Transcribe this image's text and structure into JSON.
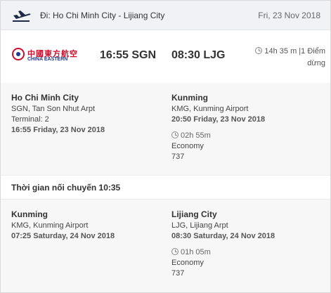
{
  "header": {
    "route": "Đi: Ho Chi Minh City - Lijiang City",
    "date": "Fri, 23 Nov 2018",
    "icon": "plane-departure-icon"
  },
  "summary": {
    "airline_logo_cn": "中國東方航空",
    "airline_logo_en": "CHINA EASTERN",
    "departure": "16:55 SGN",
    "arrival": "08:30 LJG",
    "duration": "14h 35 m |1 Điểm dừng"
  },
  "segments": [
    {
      "from": {
        "city": "Ho Chi Minh City",
        "airport": "SGN, Tan Son Nhut Arpt",
        "terminal": "Terminal: 2",
        "datetime": "16:55 Friday, 23 Nov 2018"
      },
      "to": {
        "city": "Kunming",
        "airport": "KMG, Kunming Airport",
        "datetime": "20:50 Friday, 23 Nov 2018",
        "duration": "02h 55m",
        "cabin": "Economy",
        "aircraft": "737"
      }
    },
    {
      "from": {
        "city": "Kunming",
        "airport": "KMG, Kunming Airport",
        "datetime": "07:25 Saturday, 24 Nov 2018"
      },
      "to": {
        "city": "Lijiang City",
        "airport": "LJG, Lijiang Arpt",
        "datetime": "08:30 Saturday, 24 Nov 2018",
        "duration": "01h 05m",
        "cabin": "Economy",
        "aircraft": "737"
      }
    }
  ],
  "layover": "Thời gian nối chuyến 10:35",
  "colors": {
    "brand_red": "#c8102e",
    "brand_blue": "#1e3a8a",
    "header_bg": "#f1f2f6",
    "segment_bg": "#f7f7f7"
  }
}
